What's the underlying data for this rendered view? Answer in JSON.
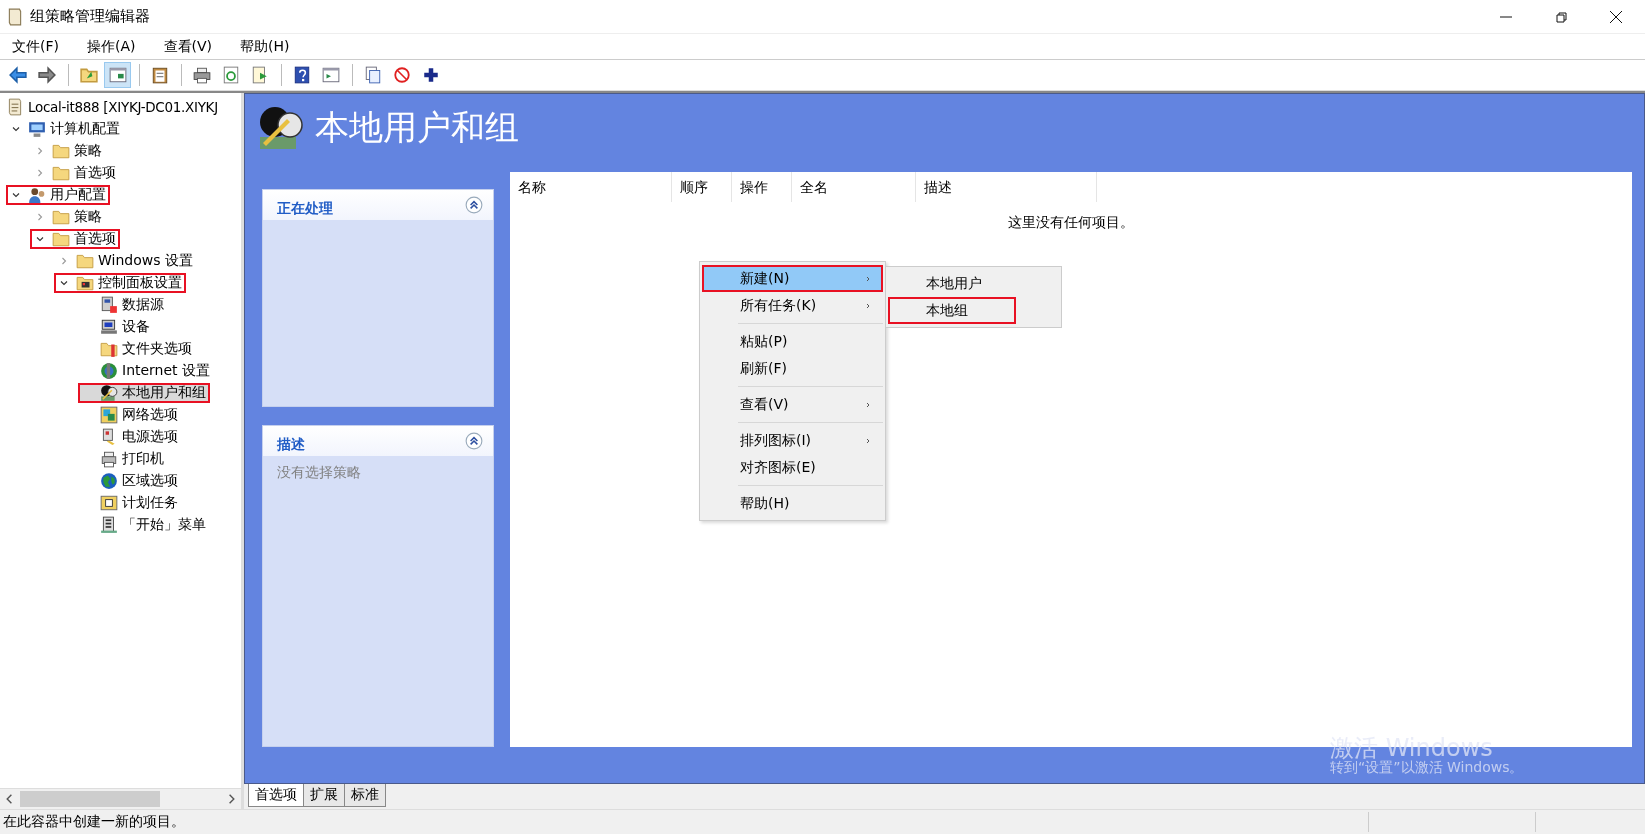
{
  "window": {
    "title": "组策略管理编辑器"
  },
  "menu": [
    "文件(F)",
    "操作(A)",
    "查看(V)",
    "帮助(H)"
  ],
  "toolbar": [
    {
      "kind": "back"
    },
    {
      "kind": "forward"
    },
    {
      "kind": "separator"
    },
    {
      "kind": "up"
    },
    {
      "kind": "tree-pane",
      "pressed": true
    },
    {
      "kind": "separator"
    },
    {
      "kind": "clipboard"
    },
    {
      "kind": "separator"
    },
    {
      "kind": "print"
    },
    {
      "kind": "refresh"
    },
    {
      "kind": "export"
    },
    {
      "kind": "separator"
    },
    {
      "kind": "help"
    },
    {
      "kind": "action-pane"
    },
    {
      "kind": "separator"
    },
    {
      "kind": "copy"
    },
    {
      "kind": "stop"
    },
    {
      "kind": "add"
    }
  ],
  "tree": [
    {
      "label": "Local-it888 [XIYKJ-DC01.XIYKJ",
      "kind": "doc",
      "selected": false,
      "highlighted": false,
      "children": [
        {
          "label": "计算机配置",
          "kind": "computer",
          "expanded": true,
          "selected": false,
          "highlighted": false,
          "children": [
            {
              "label": "策略",
              "kind": "folder",
              "expanded": false,
              "selected": false,
              "highlighted": false
            },
            {
              "label": "首选项",
              "kind": "folder",
              "expanded": false,
              "selected": false,
              "highlighted": false
            }
          ]
        },
        {
          "label": "用户配置",
          "kind": "users",
          "expanded": true,
          "selected": false,
          "highlighted": true,
          "children": [
            {
              "label": "策略",
              "kind": "folder",
              "expanded": false,
              "selected": false,
              "highlighted": false
            },
            {
              "label": "首选项",
              "kind": "folder",
              "expanded": true,
              "selected": false,
              "highlighted": true,
              "children": [
                {
                  "label": "Windows 设置",
                  "kind": "folder",
                  "expanded": false,
                  "selected": false,
                  "highlighted": false
                },
                {
                  "label": "控制面板设置",
                  "kind": "cpfolder",
                  "expanded": true,
                  "selected": false,
                  "highlighted": true,
                  "children": [
                    {
                      "label": "数据源",
                      "kind": "datasource",
                      "selected": false,
                      "highlighted": false
                    },
                    {
                      "label": "设备",
                      "kind": "device",
                      "selected": false,
                      "highlighted": false
                    },
                    {
                      "label": "文件夹选项",
                      "kind": "folderopt",
                      "selected": false,
                      "highlighted": false
                    },
                    {
                      "label": "Internet 设置",
                      "kind": "internet",
                      "selected": false,
                      "highlighted": false
                    },
                    {
                      "label": "本地用户和组",
                      "kind": "localusers",
                      "selected": true,
                      "highlighted": true
                    },
                    {
                      "label": "网络选项",
                      "kind": "network",
                      "selected": false,
                      "highlighted": false
                    },
                    {
                      "label": "电源选项",
                      "kind": "power",
                      "selected": false,
                      "highlighted": false
                    },
                    {
                      "label": "打印机",
                      "kind": "printer",
                      "selected": false,
                      "highlighted": false
                    },
                    {
                      "label": "区域选项",
                      "kind": "region",
                      "selected": false,
                      "highlighted": false
                    },
                    {
                      "label": "计划任务",
                      "kind": "task",
                      "selected": false,
                      "highlighted": false
                    },
                    {
                      "label": "「开始」菜单",
                      "kind": "start",
                      "selected": false,
                      "highlighted": false
                    }
                  ]
                }
              ]
            }
          ]
        }
      ]
    }
  ],
  "header": {
    "title": "本地用户和组",
    "kind": "localusers"
  },
  "task_panels": [
    {
      "title": "正在处理",
      "expanded": true
    },
    {
      "title": "描述",
      "expanded": true,
      "text": "没有选择策略"
    }
  ],
  "list": {
    "columns": [
      "名称",
      "顺序",
      "操作",
      "全名",
      "描述"
    ],
    "empty_text": "这里没有任何项目。"
  },
  "context_menu": {
    "items": [
      {
        "kind": "item",
        "label": "新建(N)",
        "submenu": true,
        "selected": true,
        "highlighted": true
      },
      {
        "kind": "item",
        "label": "所有任务(K)",
        "submenu": true,
        "selected": false,
        "highlighted": false
      },
      {
        "kind": "separator"
      },
      {
        "kind": "item",
        "label": "粘贴(P)",
        "submenu": false,
        "selected": false,
        "highlighted": false
      },
      {
        "kind": "item",
        "label": "刷新(F)",
        "submenu": false,
        "selected": false,
        "highlighted": false
      },
      {
        "kind": "separator"
      },
      {
        "kind": "item",
        "label": "查看(V)",
        "submenu": true,
        "selected": false,
        "highlighted": false
      },
      {
        "kind": "separator"
      },
      {
        "kind": "item",
        "label": "排列图标(I)",
        "submenu": true,
        "selected": false,
        "highlighted": false
      },
      {
        "kind": "item",
        "label": "对齐图标(E)",
        "submenu": false,
        "selected": false,
        "highlighted": false
      },
      {
        "kind": "separator"
      },
      {
        "kind": "item",
        "label": "帮助(H)",
        "submenu": false,
        "selected": false,
        "highlighted": false
      }
    ]
  },
  "submenu": {
    "items": [
      {
        "label": "本地用户",
        "highlighted": false
      },
      {
        "label": "本地组",
        "highlighted": true
      }
    ]
  },
  "bottom_tabs": [
    {
      "label": "首选项",
      "selected": true
    },
    {
      "label": "扩展",
      "selected": false
    },
    {
      "label": "标准",
      "selected": false
    }
  ],
  "activation": {
    "title": "激活 Windows",
    "text": "转到“设置”以激活 Windows。"
  },
  "status_bar": {
    "text": "在此容器中创建一新的项目。"
  }
}
